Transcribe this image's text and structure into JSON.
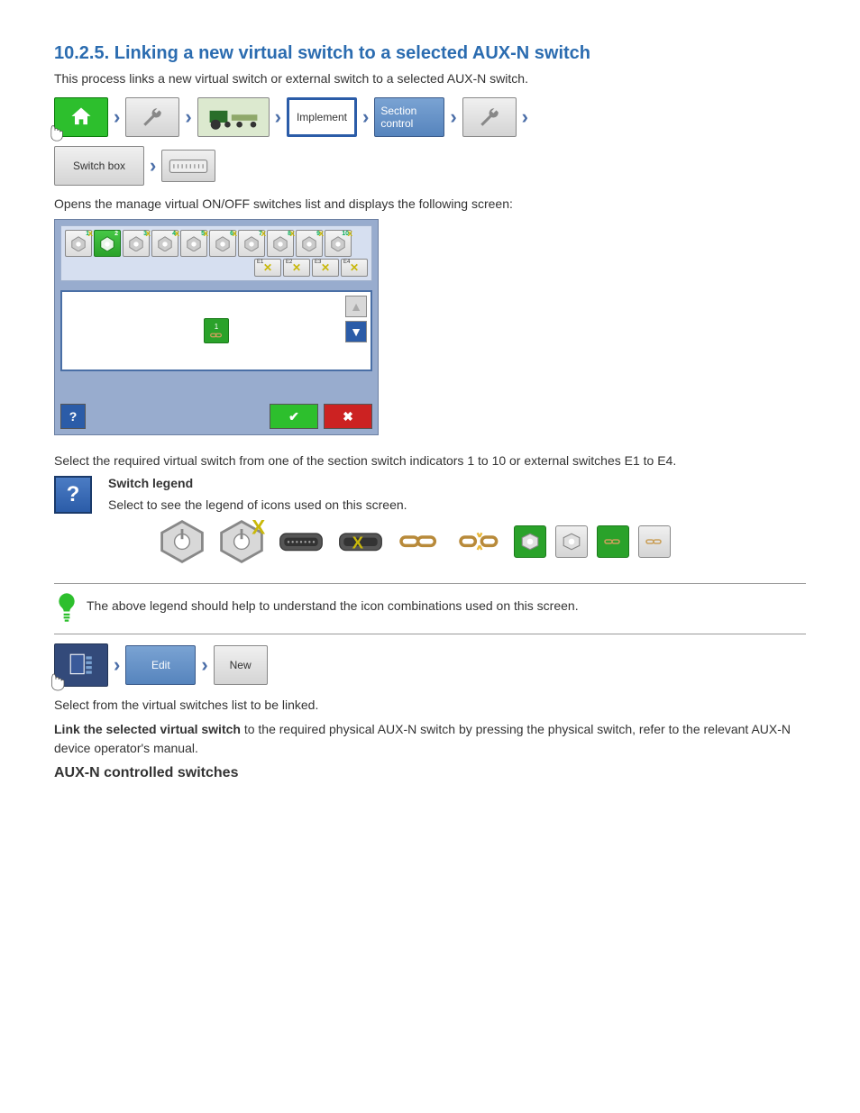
{
  "head": {
    "chapter_num": "10.2.5.",
    "chapter_title": "Linking a new virtual switch to a selected AUX-N switch",
    "intro": "This process links a new virtual switch or external switch to a selected AUX-N switch."
  },
  "path1": {
    "implement": "Implement",
    "section_control": "Section control",
    "switchbox": "Switch box",
    "desc": "Opens the manage virtual ON/OFF switches list and displays the following screen:"
  },
  "switches": {
    "count_numbered": 10,
    "selected_index": 2,
    "ext": [
      "E1",
      "E2",
      "E3",
      "E4"
    ]
  },
  "instruction_select": "Select the required virtual switch from one of the section switch indicators 1 to 10 or external switches E1 to E4.",
  "help": {
    "label": "Switch legend",
    "text": "Select to see the legend of icons used on this screen.",
    "icons": [
      {
        "n": "toggle-on",
        "cap": ""
      },
      {
        "n": "toggle-off-x",
        "cap": ""
      },
      {
        "n": "connector",
        "cap": ""
      },
      {
        "n": "connector-x",
        "cap": ""
      },
      {
        "n": "link",
        "cap": ""
      },
      {
        "n": "link-broken",
        "cap": ""
      },
      {
        "n": "box-green-toggle",
        "cap": ""
      },
      {
        "n": "box-gray-toggle",
        "cap": ""
      },
      {
        "n": "box-green-link",
        "cap": ""
      },
      {
        "n": "box-gray-link",
        "cap": ""
      }
    ]
  },
  "tip": "The above legend should help to understand the icon combinations used on this screen.",
  "path2": {
    "edit": "Edit",
    "new": "New",
    "desc": "Select from the virtual switches list to be linked."
  },
  "link_step": {
    "lead": "Link the selected virtual switch",
    "body": "to the required physical AUX-N switch by pressing the physical switch, refer to the relevant AUX-N device operator's manual.",
    "section": "AUX-N controlled switches"
  }
}
